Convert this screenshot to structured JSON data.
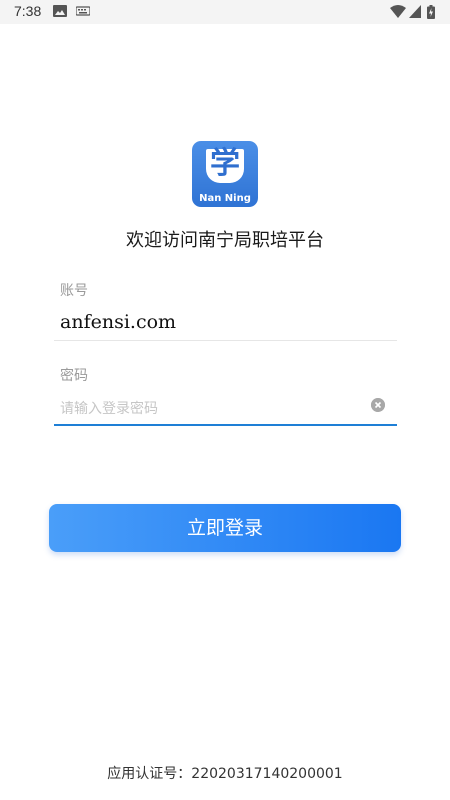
{
  "status_bar": {
    "time": "7:38",
    "icons": [
      "image-icon",
      "keyboard-icon",
      "wifi-icon",
      "signal-icon",
      "battery-icon"
    ]
  },
  "logo": {
    "char": "学",
    "text": "Nan Ning",
    "color": "#2f73d4"
  },
  "welcome": "欢迎访问南宁局职培平台",
  "account": {
    "label": "账号",
    "value": "anfensi.com"
  },
  "password": {
    "label": "密码",
    "placeholder": "请输入登录密码",
    "value": ""
  },
  "login_button": "立即登录",
  "footer": {
    "text": "应用认证号：22020317140200001"
  },
  "colors": {
    "accent": "#1e7fd6",
    "button_start": "#4a9ef9",
    "button_end": "#1a77f2"
  }
}
